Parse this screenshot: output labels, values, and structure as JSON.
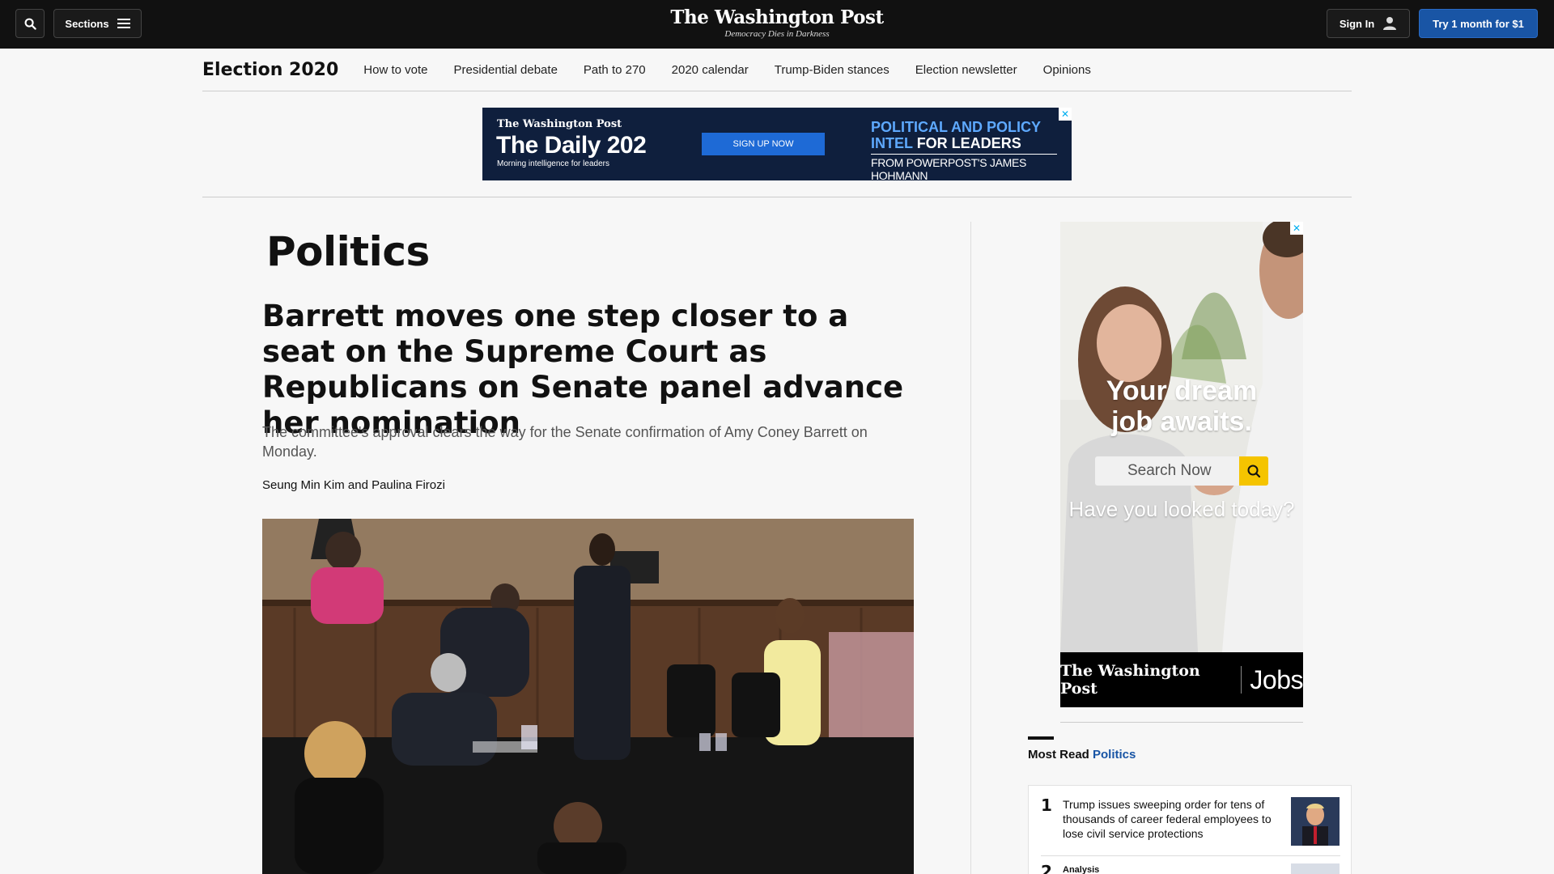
{
  "topbar": {
    "sections_label": "Sections",
    "masthead": "The Washington Post",
    "tagline": "Democracy Dies in Darkness",
    "signin_label": "Sign In",
    "try_label": "Try 1 month for $1"
  },
  "subnav": {
    "title": "Election 2020",
    "items": [
      "How to vote",
      "Presidential debate",
      "Path to 270",
      "2020 calendar",
      "Trump-Biden stances",
      "Election newsletter",
      "Opinions"
    ]
  },
  "top_ad": {
    "logo": "The Washington Post",
    "title": "The Daily 202",
    "subtitle": "Morning intelligence for leaders",
    "button": "SIGN UP NOW",
    "line1": "POLITICAL AND POLICY",
    "line2a": "INTEL",
    "line2b": "FOR LEADERS",
    "line3": "FROM POWERPOST'S JAMES HOHMANN",
    "close": "✕"
  },
  "article": {
    "kicker": "Politics",
    "headline": "Barrett moves one step closer to a seat on the Supreme Court as Republicans on Senate panel advance her nomination",
    "dek": "The committee's approval clears the way for the Senate confirmation of Amy Coney Barrett on Monday.",
    "byline": "Seung Min Kim and Paulina Firozi"
  },
  "side_ad": {
    "headline_line1": "Your dream",
    "headline_line2": "job awaits.",
    "search_placeholder": "Search Now",
    "tagline": "Have you looked today?",
    "brand": "The Washington Post",
    "brand_product": "Jobs",
    "close": "✕"
  },
  "most_read": {
    "prefix": "Most Read",
    "section": "Politics",
    "items": [
      {
        "rank": "1",
        "headline": "Trump issues sweeping order for tens of thousands of career federal employees to lose civil service protections"
      },
      {
        "rank": "2",
        "label": "Analysis"
      }
    ]
  },
  "colors": {
    "topbar": "#111111",
    "accent_blue": "#1955a5",
    "ad_navy": "#0f1f3d",
    "search_yellow": "#f5c400"
  },
  "icons": [
    "search-icon",
    "hamburger-icon",
    "user-icon",
    "close-icon",
    "magnifier-icon"
  ]
}
